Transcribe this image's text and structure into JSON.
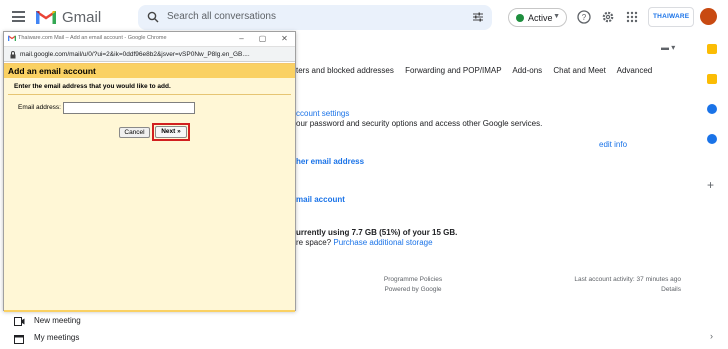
{
  "gmail": {
    "app_name": "Gmail",
    "search_placeholder": "Search all conversations",
    "status": "Active",
    "brand_badge": "THAIWARE"
  },
  "settings": {
    "tabs": [
      "ters and blocked addresses",
      "Forwarding and POP/IMAP",
      "Add-ons",
      "Chat and Meet",
      "Advanced"
    ],
    "account_settings_link": "ccount settings",
    "account_settings_desc": "our password and security options and access other Google services.",
    "edit_info": "edit info",
    "other_email_link": "her email address",
    "mail_account_link": "mail account",
    "storage_line": "urrently using 7.7 GB (51%) of your 15 GB.",
    "storage_more_prefix": "re space? ",
    "storage_more_link": "Purchase additional storage",
    "footer": {
      "programme_policies": "Programme Policies",
      "powered_by": "Powered by Google",
      "last_activity": "Last account activity: 37 minutes ago",
      "details": "Details"
    }
  },
  "meet": {
    "new_meeting": "New meeting",
    "my_meetings": "My meetings"
  },
  "popup": {
    "window_title": "Thaiware.com Mail – Add an email account - Google Chrome",
    "url": "mail.google.com/mail/u/0/?ui=2&ik=0ddf96e8b2&jsver=vSP0Nw_P8lg.en_GB....",
    "heading": "Add an email account",
    "instruction": "Enter the email address that you would like to add.",
    "email_label": "Email address:",
    "email_value": "",
    "cancel_label": "Cancel",
    "next_label": "Next »"
  },
  "colors": {
    "popup_header": "#fad163",
    "popup_body": "#fff7d6",
    "highlight": "#d11f1f",
    "link": "#1a73e8",
    "avatar": "#c84a12"
  }
}
